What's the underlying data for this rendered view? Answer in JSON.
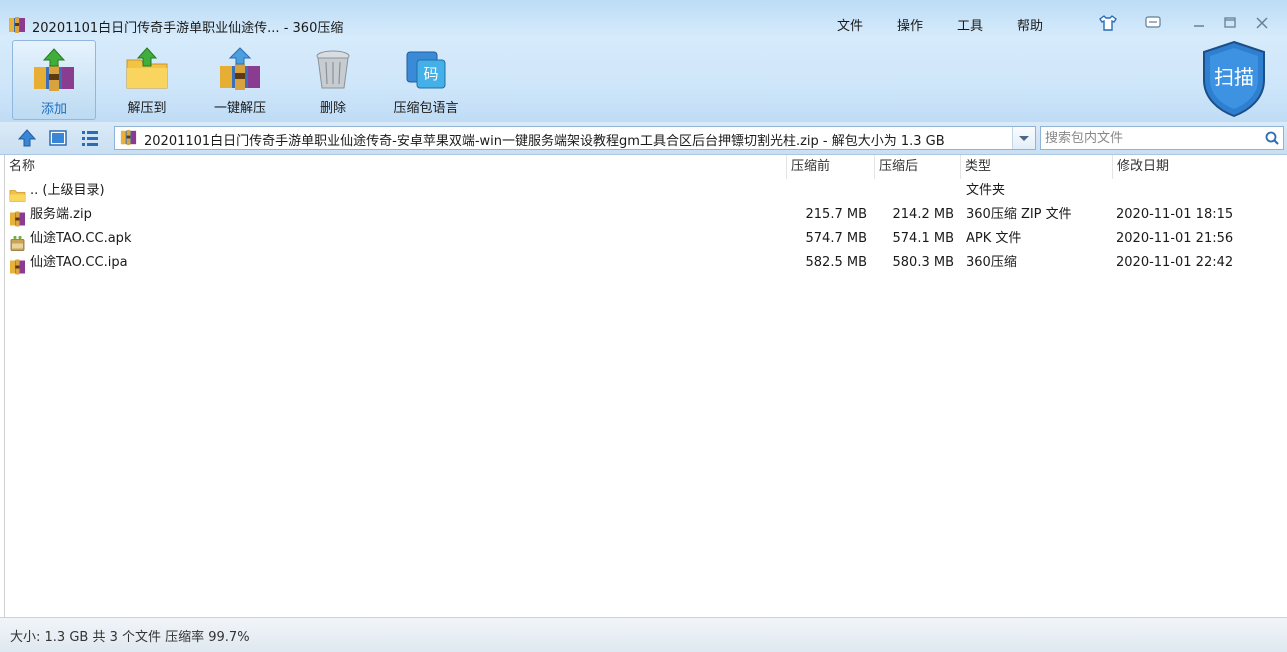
{
  "window": {
    "title": "20201101白日门传奇手游单职业仙途传... - 360压缩"
  },
  "menu": {
    "file": "文件",
    "operate": "操作",
    "tools": "工具",
    "help": "帮助"
  },
  "toolbar": {
    "add": "添加",
    "extract_to": "解压到",
    "one_click_extract": "一键解压",
    "delete": "删除",
    "archive_language": "压缩包语言",
    "scan": "扫描",
    "lang_glyph": "码"
  },
  "address": {
    "path": "20201101白日门传奇手游单职业仙途传奇-安卓苹果双端-win一键服务端架设教程gm工具合区后台押镖切割光柱.zip - 解包大小为 1.3 GB",
    "search_placeholder": "搜索包内文件"
  },
  "columns": {
    "name": "名称",
    "before": "压缩前",
    "after": "压缩后",
    "type": "类型",
    "date": "修改日期"
  },
  "rows": [
    {
      "icon": "folder-icon",
      "name": ".. (上级目录)",
      "before": "",
      "after": "",
      "type": "文件夹",
      "date": ""
    },
    {
      "icon": "archive-icon",
      "name": "服务端.zip",
      "before": "215.7 MB",
      "after": "214.2 MB",
      "type": "360压缩 ZIP 文件",
      "date": "2020-11-01 18:15"
    },
    {
      "icon": "apk-icon",
      "name": "仙途TAO.CC.apk",
      "before": "574.7 MB",
      "after": "574.1 MB",
      "type": "APK 文件",
      "date": "2020-11-01 21:56"
    },
    {
      "icon": "archive-icon",
      "name": "仙途TAO.CC.ipa",
      "before": "582.5 MB",
      "after": "580.3 MB",
      "type": "360压缩",
      "date": "2020-11-01 22:42"
    }
  ],
  "status": {
    "text": "大小: 1.3 GB 共 3 个文件 压缩率 99.7%"
  },
  "colors": {
    "accent": "#1e6fc0",
    "header_bg": "#cfe6fa",
    "scan_shield": "#2f7fd0"
  }
}
